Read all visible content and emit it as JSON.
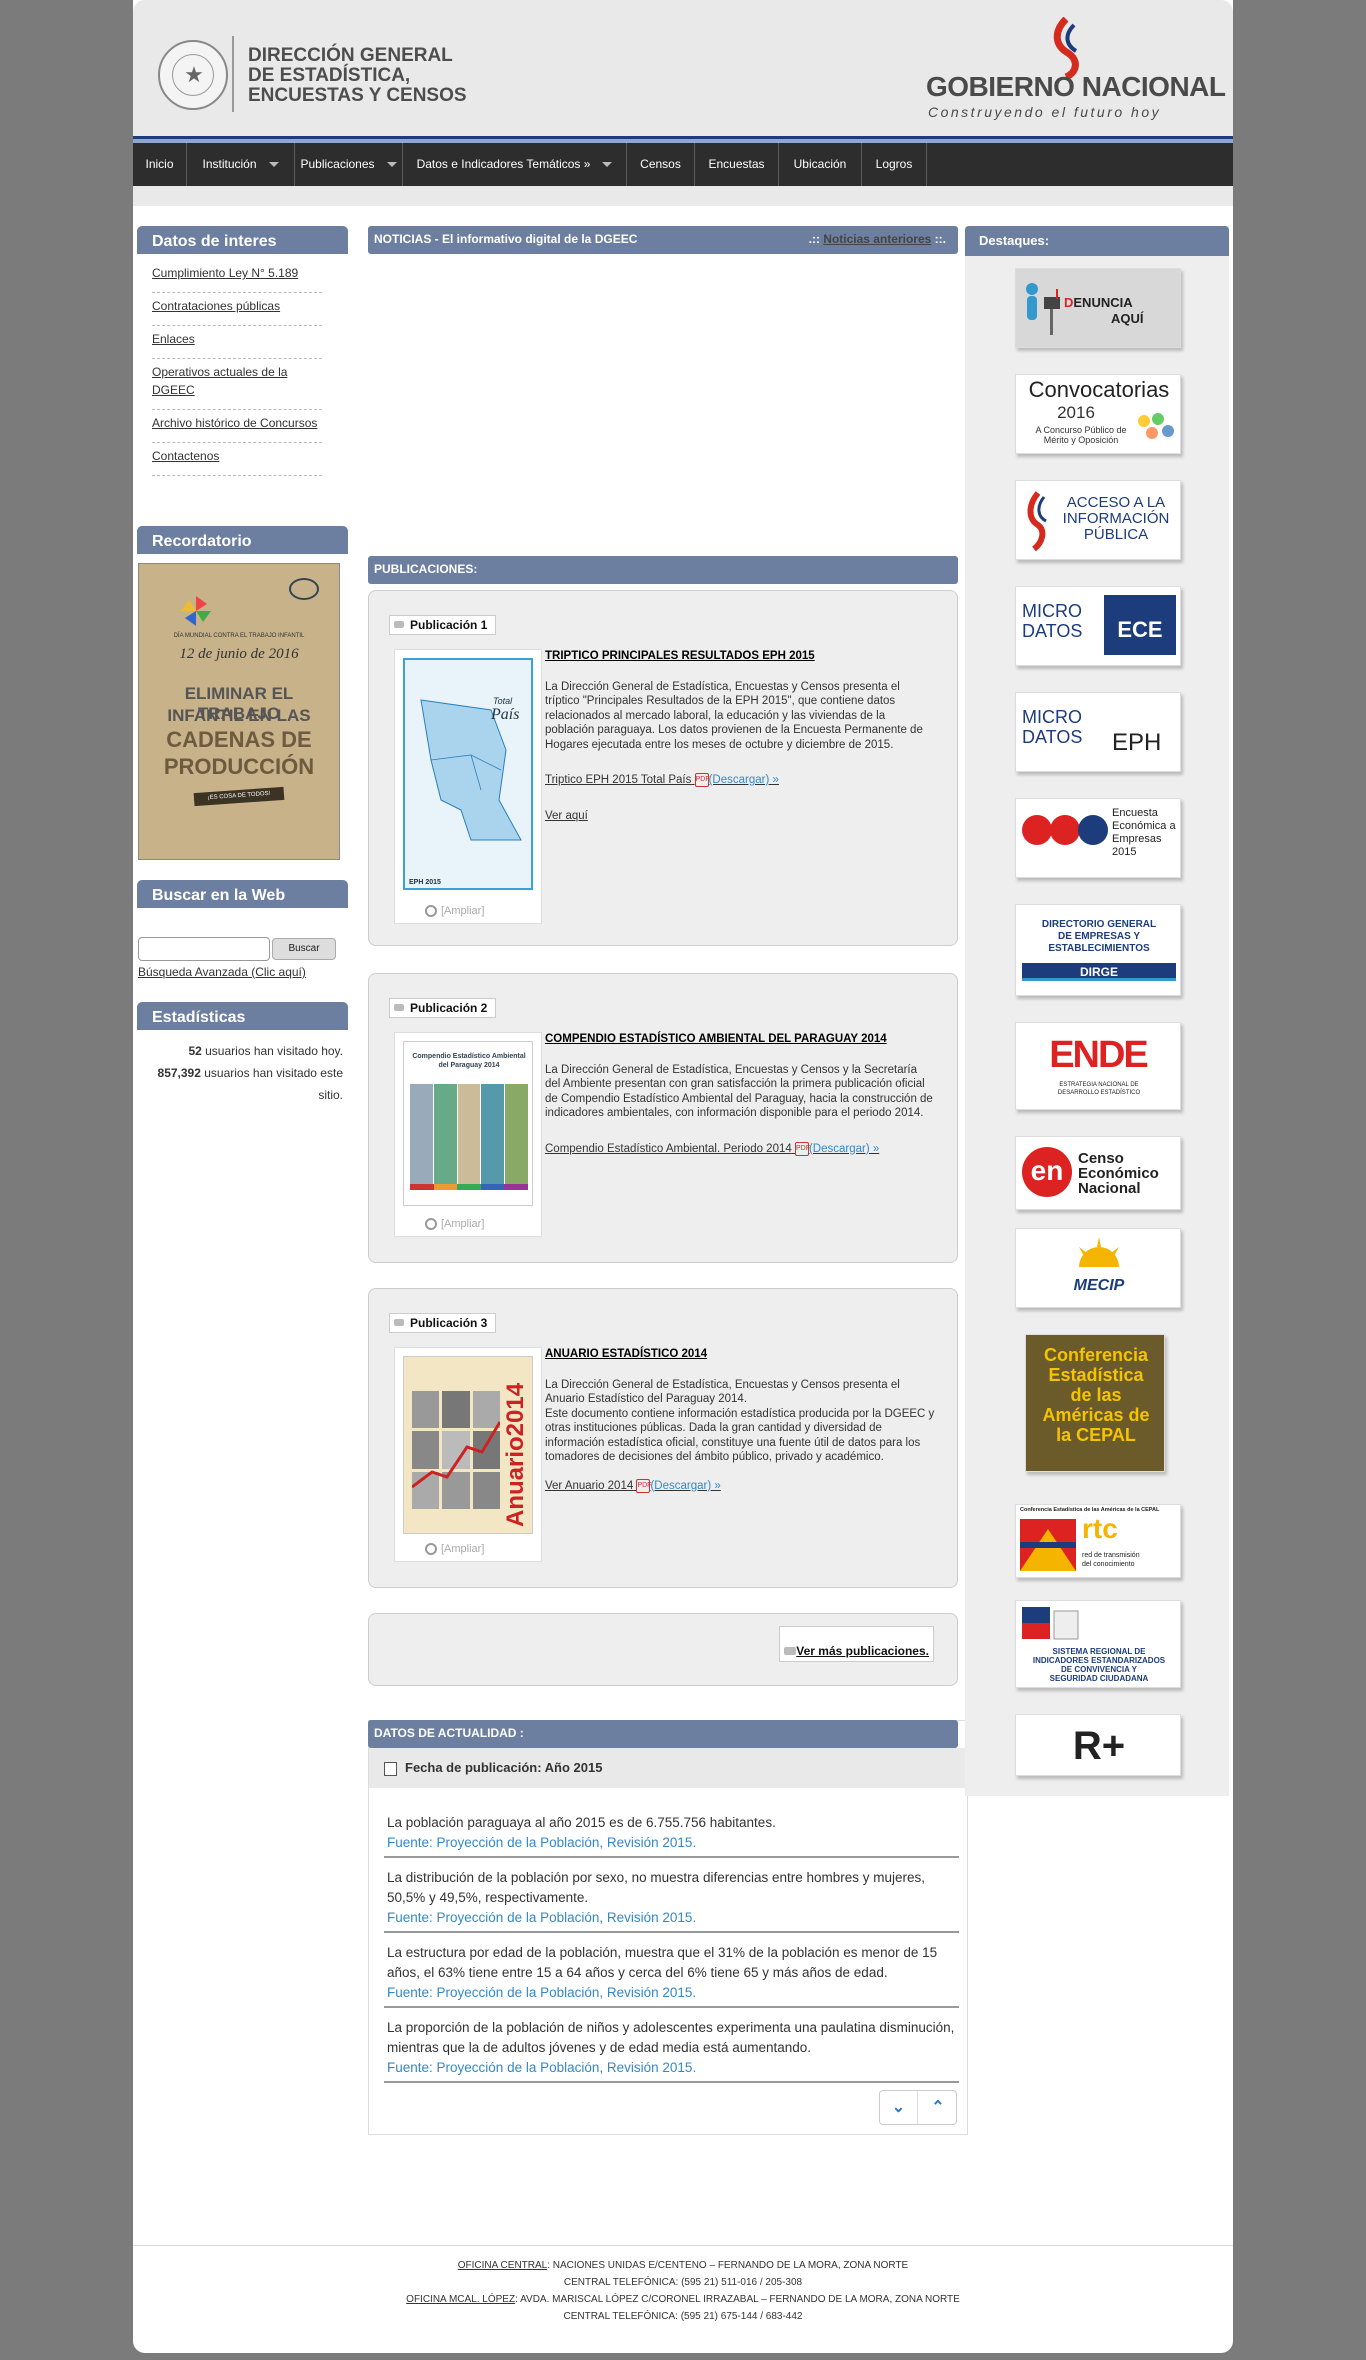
{
  "header": {
    "org_line1": "DIRECCIÓN GENERAL",
    "org_line2": "DE ESTADÍSTICA,",
    "org_line3": "ENCUESTAS Y CENSOS",
    "gov_name": "GOBIERNO NACIONAL",
    "gov_slogan": "Construyendo el futuro hoy"
  },
  "nav": {
    "items": [
      "Inicio",
      "Institución",
      "Publicaciones",
      "Datos e Indicadores Temáticos »",
      "Censos",
      "Encuestas",
      "Ubicación",
      "Logros"
    ]
  },
  "left": {
    "datos_title": "Datos de interes",
    "links": [
      "Cumplimiento Ley N° 5.189",
      "Contrataciones públicas",
      "Enlaces",
      "Operativos actuales de la DGEEC",
      "Archivo histórico de Concursos",
      "Contactenos"
    ],
    "recordatorio_title": "Recordatorio",
    "poster": {
      "line1": "DÍA MUNDIAL CONTRA EL TRABAJO INFANTIL",
      "date": "12 de junio de 2016",
      "line2": "ELIMINAR EL TRABAJO",
      "line3": "INFANTIL EN LAS",
      "line4": "CADENAS DE",
      "line5": "PRODUCCIÓN",
      "tag": "¡ES COSA DE TODOS!"
    },
    "buscar_title": "Buscar en la Web",
    "search_button": "Buscar",
    "search_advanced": "Búsqueda Avanzada (Clic aquí)",
    "stats_title": "Estadísticas",
    "stats_today_count": "52",
    "stats_today_text": " usuarios han visitado hoy.",
    "stats_total_count": "857,392",
    "stats_total_text": " usuarios han visitado este sitio."
  },
  "noticias": {
    "title": "NOTICIAS - El informativo digital de la DGEEC",
    "prev_prefix": ".:: ",
    "prev_link": "Noticias anteriores",
    "prev_suffix": " ::."
  },
  "publicaciones": {
    "title": "PUBLICACIONES:",
    "items": [
      {
        "tag": "Publicación 1",
        "title": "TRIPTICO PRINCIPALES RESULTADOS EPH 2015",
        "body": "La Dirección General de Estadística, Encuestas y Censos presenta el tríptico \"Principales Resultados de la EPH 2015\", que contiene datos relacionados al mercado laboral, la educación y las viviendas de la población paraguaya. Los datos provienen de la Encuesta Permanente de Hogares ejecutada entre los meses de octubre y diciembre de 2015.",
        "link": "Triptico EPH 2015 Total País",
        "download": "(Descargar) »",
        "extra": "Ver aquí",
        "ampliar": "[Ampliar]",
        "thumb_label": "EPH 2015",
        "thumb_total": "Total",
        "thumb_pais": "País"
      },
      {
        "tag": "Publicación 2",
        "title": "COMPENDIO ESTADÍSTICO AMBIENTAL DEL PARAGUAY 2014",
        "body": "La Dirección General de Estadística, Encuestas y Censos y la Secretaría del Ambiente presentan con gran satisfacción la primera publicación oficial de Compendio Estadístico Ambiental del Paraguay, hacia la construcción de indicadores ambientales, con información disponible para el periodo 2014.",
        "link": "Compendio Estadístico Ambiental. Periodo 2014",
        "download": "(Descargar) »",
        "ampliar": "[Ampliar]",
        "thumb_label": "Compendio Estadístico Ambiental del Paraguay 2014"
      },
      {
        "tag": "Publicación 3",
        "title": "ANUARIO ESTADÍSTICO 2014",
        "body": "La Dirección General de Estadística, Encuestas y Censos presenta el Anuario Estadístico del Paraguay 2014.\nEste documento contiene información estadística producida por la DGEEC y otras instituciones públicas. Dada la gran cantidad y diversidad de información estadística oficial, constituye una fuente útil de datos para los tomadores de decisiones del ámbito público, privado y académico.",
        "link": "Ver Anuario 2014",
        "download": "(Descargar) »",
        "ampliar": "[Ampliar]",
        "thumb_label": "Anuario2014"
      }
    ],
    "more": "Ver más publicaciones."
  },
  "datos_actualidad": {
    "title": "DATOS DE ACTUALIDAD :",
    "subtitle": "Fecha de publicación: Año 2015",
    "rows": [
      {
        "text": "La población paraguaya al año 2015 es de 6.755.756 habitantes.",
        "source": "Fuente: Proyección de la Población, Revisión 2015."
      },
      {
        "text": "La distribución de la población por sexo, no muestra diferencias entre hombres y mujeres, 50,5% y 49,5%, respectivamente.",
        "source": "Fuente: Proyección de la Población, Revisión 2015."
      },
      {
        "text": "La estructura por edad de la población, muestra que el 31% de la población es menor de 15 años, el 63% tiene entre 15 a 64 años y cerca del 6% tiene 65 y más años de edad.",
        "source": "Fuente: Proyección de la Población, Revisión 2015."
      },
      {
        "text": "La proporción de la población de niños y adolescentes experimenta una paulatina disminución, mientras que la de adultos jóvenes y de edad media está aumentando.",
        "source": "Fuente: Proyección de la Población, Revisión 2015."
      }
    ]
  },
  "destaques": {
    "title": "Destaques:",
    "denuncia_a": "D",
    "denuncia_b": "ENUNCIA",
    "denuncia_c": "AQUÍ",
    "conv_title": "Convocatorias",
    "conv_year": "2016",
    "conv_sub1": "A Concurso Público de",
    "conv_sub2": "Mérito y Oposición",
    "acceso1": "ACCESO A LA",
    "acceso2": "INFORMACIÓN",
    "acceso3": "PÚBLICA",
    "micro1": "MICRO",
    "micro2": "DATOS",
    "ece": "ECE",
    "eph": "EPH",
    "eee1": "Encuesta",
    "eee2": "Económica a",
    "eee3": "Empresas",
    "eee4": "2015",
    "dirge1": "DIRECTORIO GENERAL",
    "dirge2": "DE EMPRESAS Y",
    "dirge3": "ESTABLECIMIENTOS",
    "dirge4": "DIRGE",
    "ende": "ENDE",
    "ende_sub1": "ESTRATEGIA NACIONAL DE",
    "ende_sub2": "DESARROLLO ESTADÍSTICO",
    "censo1": "Censo",
    "censo2": "Económico",
    "censo3": "Nacional",
    "mecip": "MECIP",
    "cepal1": "Conferencia",
    "cepal2": "Estadística",
    "cepal3": "de las",
    "cepal4": "Américas de",
    "cepal5": "la CEPAL",
    "rtc_head": "Conferencia Estadística de las Américas de la CEPAL",
    "rtc": "rtc",
    "rtc_sub1": "red de transmisión",
    "rtc_sub2": "del conocimiento",
    "siscs1": "SISTEMA REGIONAL DE",
    "siscs2": "INDICADORES ESTANDARIZADOS",
    "siscs3": "DE CONVIVENCIA Y",
    "siscs4": "SEGURIDAD CIUDADANA",
    "rplus": "R+"
  },
  "footer": {
    "l1_label": "OFICINA CENTRAL",
    "l1_text": ": NACIONES UNIDAS E/CENTENO – FERNANDO DE LA MORA, ZONA NORTE",
    "l2": "CENTRAL TELEFÓNICA: (595 21) 511-016 / 205-308",
    "l3_label": "OFICINA MCAL. LÓPEZ",
    "l3_text": ": AVDA. MARISCAL LÓPEZ C/CORONEL IRRAZABAL – FERNANDO DE LA MORA, ZONA NORTE",
    "l4": "CENTRAL TELEFÓNICA: (595 21) 675-144 / 683-442"
  }
}
